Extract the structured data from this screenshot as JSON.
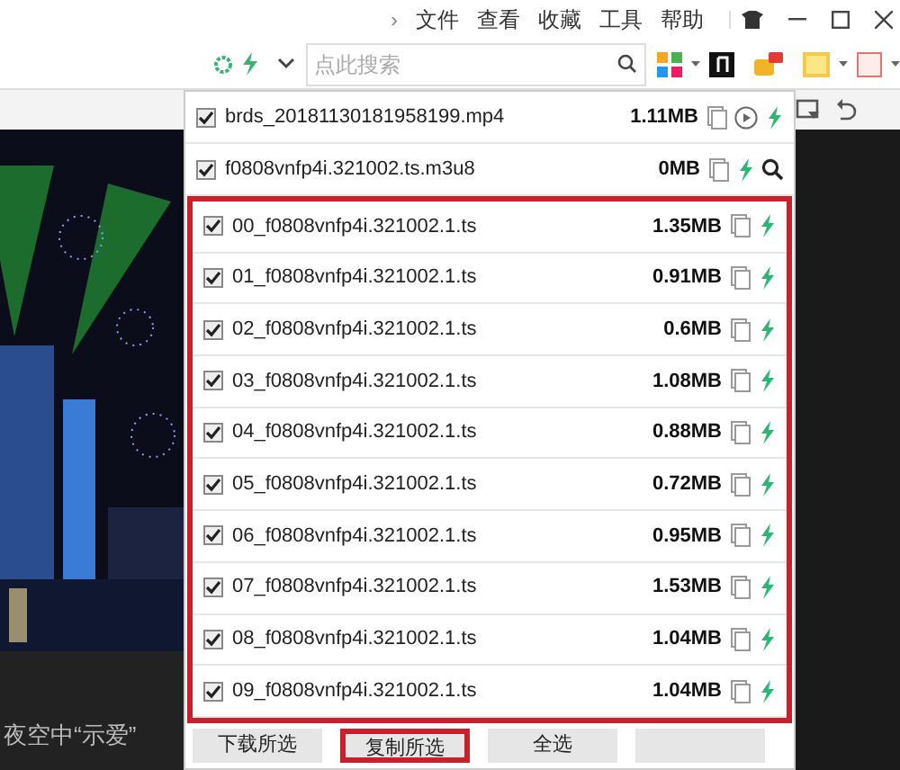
{
  "menu_bar": {
    "chevron": "›",
    "items": [
      "文件",
      "查看",
      "收藏",
      "工具",
      "帮助"
    ]
  },
  "search": {
    "placeholder": "点此搜索"
  },
  "video_caption": "夜空中“示爱”",
  "media_list": {
    "top_items": [
      {
        "name": "brds_20181130181958199.mp4",
        "size": "1.11MB",
        "checked": true,
        "kind": "video"
      },
      {
        "name": "f0808vnfp4i.321002.ts.m3u8",
        "size": "0MB",
        "checked": true,
        "kind": "playlist"
      }
    ],
    "segments": [
      {
        "name": "00_f0808vnfp4i.321002.1.ts",
        "size": "1.35MB",
        "checked": true
      },
      {
        "name": "01_f0808vnfp4i.321002.1.ts",
        "size": "0.91MB",
        "checked": true
      },
      {
        "name": "02_f0808vnfp4i.321002.1.ts",
        "size": "0.6MB",
        "checked": true
      },
      {
        "name": "03_f0808vnfp4i.321002.1.ts",
        "size": "1.08MB",
        "checked": true
      },
      {
        "name": "04_f0808vnfp4i.321002.1.ts",
        "size": "0.88MB",
        "checked": true
      },
      {
        "name": "05_f0808vnfp4i.321002.1.ts",
        "size": "0.72MB",
        "checked": true
      },
      {
        "name": "06_f0808vnfp4i.321002.1.ts",
        "size": "0.95MB",
        "checked": true
      },
      {
        "name": "07_f0808vnfp4i.321002.1.ts",
        "size": "1.53MB",
        "checked": true
      },
      {
        "name": "08_f0808vnfp4i.321002.1.ts",
        "size": "1.04MB",
        "checked": true
      },
      {
        "name": "09_f0808vnfp4i.321002.1.ts",
        "size": "1.04MB",
        "checked": true
      }
    ],
    "buttons": [
      {
        "label": "下载所选",
        "highlighted": false
      },
      {
        "label": "复制所选",
        "highlighted": true
      },
      {
        "label": "全选",
        "highlighted": false
      },
      {
        "highlighted": false
      }
    ]
  }
}
